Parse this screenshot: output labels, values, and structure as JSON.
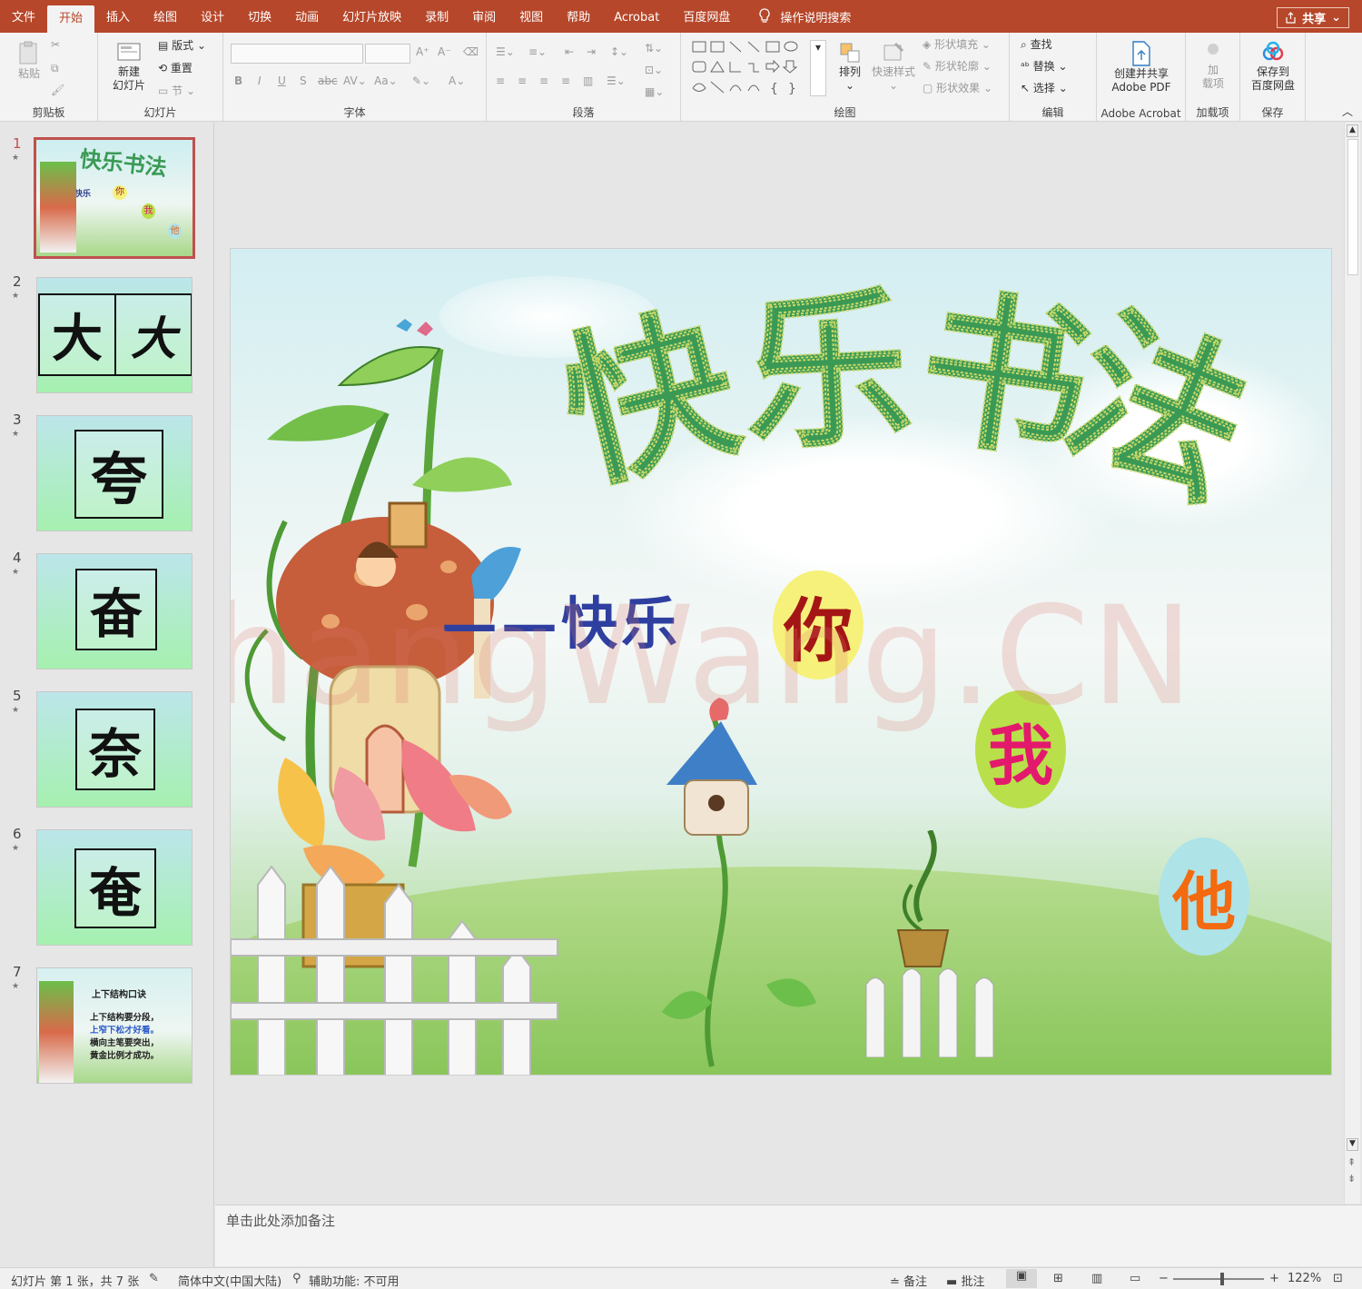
{
  "tabs": [
    "文件",
    "开始",
    "插入",
    "绘图",
    "设计",
    "切换",
    "动画",
    "幻灯片放映",
    "录制",
    "审阅",
    "视图",
    "帮助",
    "Acrobat",
    "百度网盘"
  ],
  "active_tab_index": 1,
  "tellme": "操作说明搜索",
  "share": "共享",
  "ribbon": {
    "paste": "粘贴",
    "clipboard": "剪贴板",
    "new_slide_1": "新建",
    "new_slide_2": "幻灯片",
    "layout": "版式",
    "reset": "重置",
    "section": "节",
    "slides": "幻灯片",
    "font": "字体",
    "paragraph": "段落",
    "arrange": "排列",
    "quick_styles": "快速样式",
    "shape_fill": "形状填充",
    "shape_outline": "形状轮廓",
    "shape_effects": "形状效果",
    "drawing": "绘图",
    "find": "查找",
    "replace": "替换",
    "select": "选择",
    "editing": "编辑",
    "create_pdf_1": "创建并共享",
    "create_pdf_2": "Adobe PDF",
    "adobe": "Adobe Acrobat",
    "addins_btn_1": "加",
    "addins_btn_2": "载项",
    "addins": "加载项",
    "save_baidu_1": "保存到",
    "save_baidu_2": "百度网盘",
    "save": "保存"
  },
  "thumbnails": [
    {
      "num": "1",
      "title": "快乐书法"
    },
    {
      "num": "2",
      "chars": [
        "大",
        "大"
      ]
    },
    {
      "num": "3",
      "char": "夸"
    },
    {
      "num": "4",
      "char": "奋"
    },
    {
      "num": "5",
      "char": "奈"
    },
    {
      "num": "6",
      "char": "奄"
    },
    {
      "num": "7",
      "title": "上下结构口诀",
      "lines": [
        "上下结构要分段，",
        "上窄下松才好看。",
        "横向主笔要突出，",
        "黄金比例才成功。"
      ]
    }
  ],
  "thumb1_small": [
    "快乐",
    "你",
    "我",
    "他"
  ],
  "slide": {
    "title": "快乐书法",
    "subtitle": "——快乐",
    "bubbles": [
      "你",
      "我",
      "他"
    ],
    "watermark": "ShangWang.CN"
  },
  "notes_placeholder": "单击此处添加备注",
  "status": {
    "slide_info": "幻灯片 第 1 张，共 7 张",
    "language": "简体中文(中国大陆)",
    "accessibility": "辅助功能: 不可用",
    "notes": "备注",
    "comments": "批注",
    "zoom": "122%"
  },
  "colors": {
    "accent": "#b7472a",
    "title_green": "#3a9a55",
    "bubble1": "#f6f17a",
    "bubble2": "#b9e04a",
    "bubble3": "#aee3e8"
  }
}
